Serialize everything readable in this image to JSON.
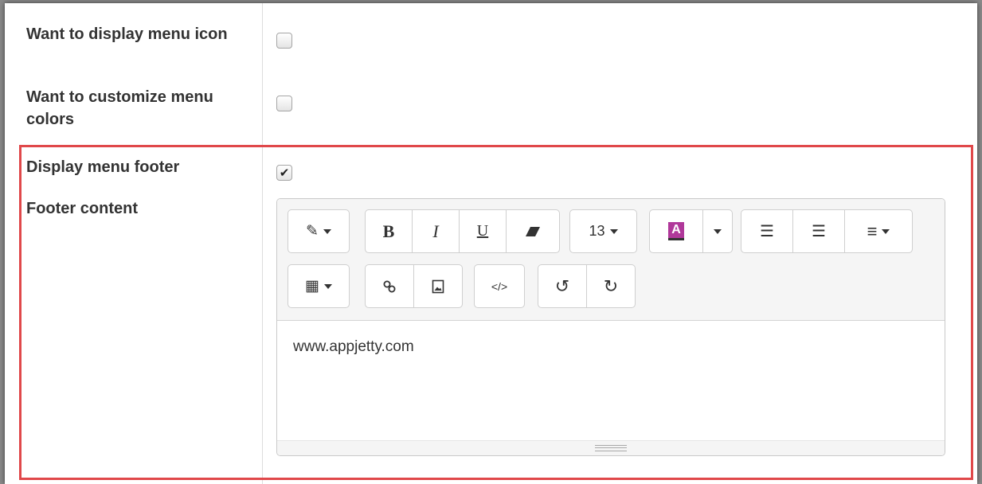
{
  "settings": {
    "menu_icon_label": "Want to display menu icon",
    "menu_colors_label": "Want to customize menu colors",
    "menu_footer_label": "Display menu footer",
    "footer_content_label": "Footer content",
    "menu_icon_checked": false,
    "menu_colors_checked": false,
    "menu_footer_checked": true
  },
  "editor": {
    "font_size": "13",
    "content": "www.appjetty.com",
    "highlight_color": "#e0484a",
    "font_color_swatch": "#b0389a"
  },
  "icons": {
    "checkmark": "✔",
    "magic": "✎",
    "bold": "B",
    "italic": "I",
    "underline": "U",
    "eraser": "eraser-icon",
    "font_color": "A",
    "bullet_list": "☰",
    "numbered_list": "☰",
    "align": "≡",
    "table": "▦",
    "link": "link-icon",
    "picture": "picture-icon",
    "code": "</>",
    "undo": "↺",
    "redo": "↻"
  }
}
